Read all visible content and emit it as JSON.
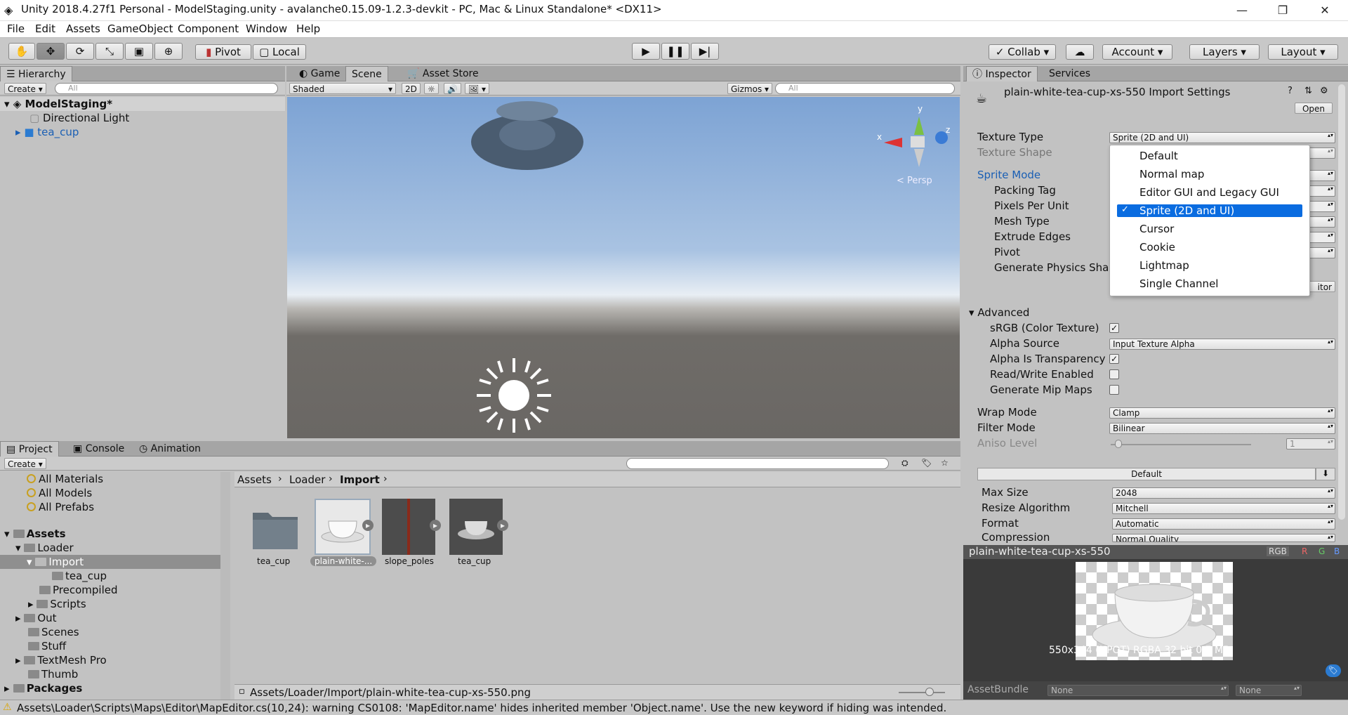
{
  "window": {
    "title": "Unity 2018.4.27f1 Personal - ModelStaging.unity - avalanche0.15.09-1.2.3-devkit - PC, Mac & Linux Standalone* <DX11>",
    "min": "—",
    "max": "❐",
    "close": "✕"
  },
  "menu": [
    "File",
    "Edit",
    "Assets",
    "GameObject",
    "Component",
    "Window",
    "Help"
  ],
  "toolbar": {
    "pivot": "Pivot",
    "local": "Local",
    "collab": "Collab",
    "account": "Account",
    "layers": "Layers",
    "layout": "Layout"
  },
  "hierarchy": {
    "tab": "Hierarchy",
    "create": "Create",
    "search_placeholder": "All",
    "scene": "ModelStaging*",
    "items": [
      "Directional Light",
      "tea_cup"
    ]
  },
  "scene_tabs": [
    "Game",
    "Scene",
    "Asset Store"
  ],
  "scene_toolbar": {
    "shading": "Shaded",
    "mode2d": "2D",
    "gizmos": "Gizmos",
    "search_placeholder": "All"
  },
  "gizmo": {
    "x": "x",
    "y": "y",
    "z": "z",
    "persp": "< Persp"
  },
  "inspector": {
    "tabs": [
      "Inspector",
      "Services"
    ],
    "title": "plain-white-tea-cup-xs-550 Import Settings",
    "open": "Open",
    "texture_type_label": "Texture Type",
    "texture_type_value": "Sprite (2D and UI)",
    "texture_shape_label": "Texture Shape",
    "sprite_fields": [
      "Sprite Mode",
      "Packing Tag",
      "Pixels Per Unit",
      "Mesh Type",
      "Extrude Edges",
      "Pivot",
      "Generate Physics Shap"
    ],
    "editor_btn": "itor",
    "advanced": "Advanced",
    "adv_rows": [
      {
        "label": "sRGB (Color Texture)",
        "checked": true
      },
      {
        "label": "Alpha Source",
        "value": "Input Texture Alpha"
      },
      {
        "label": "Alpha Is Transparency",
        "checked": true
      },
      {
        "label": "Read/Write Enabled",
        "checked": false
      },
      {
        "label": "Generate Mip Maps",
        "checked": false
      }
    ],
    "wrap_label": "Wrap Mode",
    "wrap_value": "Clamp",
    "filter_label": "Filter Mode",
    "filter_value": "Bilinear",
    "aniso_label": "Aniso Level",
    "aniso_value": "1",
    "platform_tab": "Default",
    "platform_rows": [
      {
        "label": "Max Size",
        "value": "2048"
      },
      {
        "label": "Resize Algorithm",
        "value": "Mitchell"
      },
      {
        "label": "Format",
        "value": "Automatic"
      },
      {
        "label": "Compression",
        "value": "Normal Quality"
      }
    ]
  },
  "texture_type_options": [
    "Default",
    "Normal map",
    "Editor GUI and Legacy GUI",
    "Sprite (2D and UI)",
    "Cursor",
    "Cookie",
    "Lightmap",
    "Single Channel"
  ],
  "texture_type_selected": "Sprite (2D and UI)",
  "preview": {
    "name": "plain-white-tea-cup-xs-550",
    "rgb": "RGB",
    "r": "R",
    "g": "G",
    "b": "B",
    "info": "550x344 (NPOT)  RGBA 32 bit  0.7 MB",
    "assetbundle_label": "AssetBundle",
    "ab_none1": "None",
    "ab_none2": "None"
  },
  "bottom_tabs": [
    "Project",
    "Console",
    "Animation"
  ],
  "project": {
    "create": "Create",
    "favorites": [
      "All Materials",
      "All Models",
      "All Prefabs"
    ],
    "tree": [
      {
        "label": "Assets",
        "bold": true,
        "d": 0
      },
      {
        "label": "Loader",
        "d": 1
      },
      {
        "label": "Import",
        "d": 2
      },
      {
        "label": "tea_cup",
        "d": 3
      },
      {
        "label": "Precompiled",
        "d": 2
      },
      {
        "label": "Scripts",
        "d": 2
      },
      {
        "label": "Out",
        "d": 1
      },
      {
        "label": "Scenes",
        "d": 1
      },
      {
        "label": "Stuff",
        "d": 1
      },
      {
        "label": "TextMesh Pro",
        "d": 1
      },
      {
        "label": "Thumb",
        "d": 1
      },
      {
        "label": "Packages",
        "bold": true,
        "d": 0
      }
    ],
    "breadcrumb": [
      "Assets",
      "Loader",
      "Import"
    ],
    "assets": [
      "tea_cup",
      "plain-white-...",
      "slope_poles",
      "tea_cup"
    ],
    "path": "Assets/Loader/Import/plain-white-tea-cup-xs-550.png"
  },
  "status": "Assets\\Loader\\Scripts\\Maps\\Editor\\MapEditor.cs(10,24): warning CS0108: 'MapEditor.name' hides inherited member 'Object.name'. Use the new keyword if hiding was intended.",
  "colors": {
    "selection": "#0a6ce0",
    "link": "#1a5fb4",
    "sky_top": "#7fa7d6",
    "ground": "#6d6a66"
  }
}
